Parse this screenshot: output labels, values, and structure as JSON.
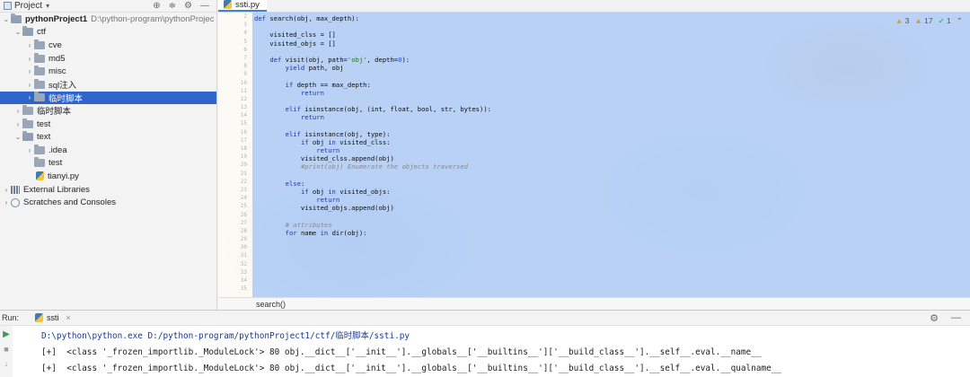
{
  "project_panel": {
    "title": "Project",
    "tree": [
      {
        "label": "pythonProject1",
        "path": "D:\\python-program\\pythonProjec",
        "depth": 0,
        "arrow": "⌄",
        "kind": "folder-open",
        "bold": true
      },
      {
        "label": "ctf",
        "depth": 1,
        "arrow": "⌄",
        "kind": "folder-open"
      },
      {
        "label": "cve",
        "depth": 2,
        "arrow": "›",
        "kind": "folder"
      },
      {
        "label": "md5",
        "depth": 2,
        "arrow": "›",
        "kind": "folder"
      },
      {
        "label": "misc",
        "depth": 2,
        "arrow": "›",
        "kind": "folder"
      },
      {
        "label": "sql注入",
        "depth": 2,
        "arrow": "›",
        "kind": "folder"
      },
      {
        "label": "临时脚本",
        "depth": 2,
        "arrow": "›",
        "kind": "folder",
        "selected": true
      },
      {
        "label": "临时脚本",
        "depth": 1,
        "arrow": "›",
        "kind": "folder"
      },
      {
        "label": "test",
        "depth": 1,
        "arrow": "›",
        "kind": "folder"
      },
      {
        "label": "text",
        "depth": 1,
        "arrow": "⌄",
        "kind": "folder-open"
      },
      {
        "label": ".idea",
        "depth": 2,
        "arrow": "›",
        "kind": "folder"
      },
      {
        "label": "test",
        "depth": 2,
        "arrow": "",
        "kind": "folder"
      },
      {
        "label": "tianyi.py",
        "depth": 2,
        "arrow": "",
        "kind": "py"
      },
      {
        "label": "External Libraries",
        "depth": 0,
        "arrow": "›",
        "kind": "lib"
      },
      {
        "label": "Scratches and Consoles",
        "depth": 0,
        "arrow": "›",
        "kind": "scratch"
      }
    ]
  },
  "editor": {
    "tab_label": "ssti.py",
    "inspections": {
      "warnings": "3",
      "weak_warnings": "17",
      "ok": "1"
    },
    "line_numbers": [
      "2",
      "3",
      "4",
      "5",
      "6",
      "7",
      "8",
      "9",
      "10",
      "11",
      "12",
      "13",
      "14",
      "15",
      "16",
      "17",
      "18",
      "19",
      "20",
      "21",
      "22",
      "23",
      "24",
      "25",
      "26",
      "27",
      "28",
      "29",
      "30",
      "31",
      "32",
      "33",
      "34",
      "35"
    ],
    "code_lines": [
      [
        {
          "t": "def ",
          "c": "kw"
        },
        {
          "t": "search(obj, max_depth):"
        }
      ],
      [],
      [
        {
          "t": "    visited_clss = []"
        }
      ],
      [
        {
          "t": "    visited_objs = []"
        }
      ],
      [],
      [
        {
          "t": "    "
        },
        {
          "t": "def ",
          "c": "kw"
        },
        {
          "t": "visit(obj, path="
        },
        {
          "t": "'obj'",
          "c": "str"
        },
        {
          "t": ", depth="
        },
        {
          "t": "0",
          "c": "num"
        },
        {
          "t": "):"
        }
      ],
      [
        {
          "t": "        "
        },
        {
          "t": "yield ",
          "c": "kw"
        },
        {
          "t": "path, obj"
        }
      ],
      [],
      [
        {
          "t": "        "
        },
        {
          "t": "if ",
          "c": "kw"
        },
        {
          "t": "depth == max_depth:"
        }
      ],
      [
        {
          "t": "            "
        },
        {
          "t": "return",
          "c": "kw"
        }
      ],
      [],
      [
        {
          "t": "        "
        },
        {
          "t": "elif ",
          "c": "kw"
        },
        {
          "t": "isinstance(obj, (int, float, bool, str, bytes)):"
        }
      ],
      [
        {
          "t": "            "
        },
        {
          "t": "return",
          "c": "kw"
        }
      ],
      [],
      [
        {
          "t": "        "
        },
        {
          "t": "elif ",
          "c": "kw"
        },
        {
          "t": "isinstance(obj, type):"
        }
      ],
      [
        {
          "t": "            "
        },
        {
          "t": "if ",
          "c": "kw"
        },
        {
          "t": "obj "
        },
        {
          "t": "in ",
          "c": "kw"
        },
        {
          "t": "visited_clss:"
        }
      ],
      [
        {
          "t": "                "
        },
        {
          "t": "return",
          "c": "kw"
        }
      ],
      [
        {
          "t": "            visited_clss.append(obj)"
        }
      ],
      [
        {
          "t": "            "
        },
        {
          "t": "#print(obj) Enumerate the objects traversed",
          "c": "cmt"
        }
      ],
      [],
      [
        {
          "t": "        "
        },
        {
          "t": "else",
          "c": "kw"
        },
        {
          "t": ":"
        }
      ],
      [
        {
          "t": "            "
        },
        {
          "t": "if ",
          "c": "kw"
        },
        {
          "t": "obj "
        },
        {
          "t": "in ",
          "c": "kw"
        },
        {
          "t": "visited_objs:"
        }
      ],
      [
        {
          "t": "                "
        },
        {
          "t": "return",
          "c": "kw"
        }
      ],
      [
        {
          "t": "            visited_objs.append(obj)"
        }
      ],
      [],
      [
        {
          "t": "        "
        },
        {
          "t": "# attributes",
          "c": "cmt"
        }
      ],
      [
        {
          "t": "        "
        },
        {
          "t": "for ",
          "c": "kw"
        },
        {
          "t": "name "
        },
        {
          "t": "in ",
          "c": "kw"
        },
        {
          "t": "dir(obj):"
        }
      ]
    ],
    "breadcrumb": "search()"
  },
  "run_panel": {
    "label": "Run:",
    "tab_label": "ssti",
    "lines": [
      "D:\\python\\python.exe D:/python-program/pythonProject1/ctf/临时脚本/ssti.py",
      "[+]  <class '_frozen_importlib._ModuleLock'> 80 obj.__dict__['__init__'].__globals__['__builtins__']['__build_class__'].__self__.eval.__name__",
      "[+]  <class '_frozen_importlib._ModuleLock'> 80 obj.__dict__['__init__'].__globals__['__builtins__']['__build_class__'].__self__.eval.__qualname__"
    ]
  }
}
